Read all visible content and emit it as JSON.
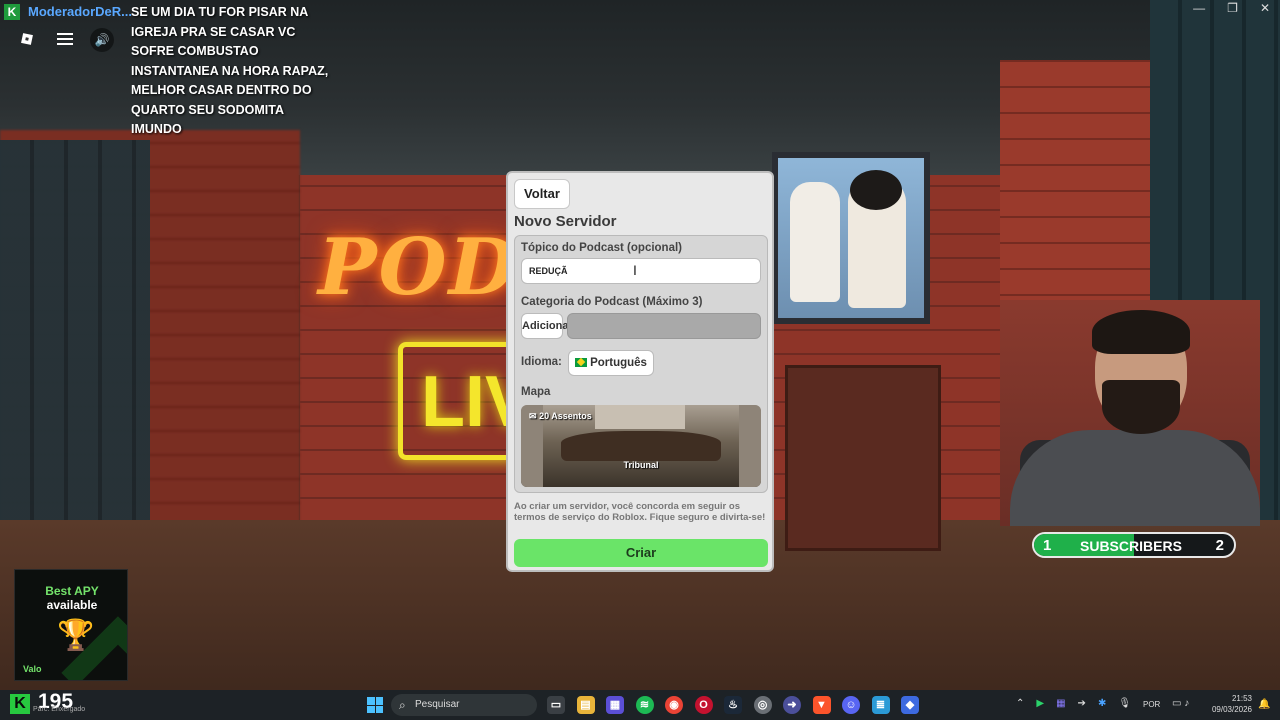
{
  "app": {
    "title_short": "Roblox"
  },
  "chat": {
    "username": "ModeradorDeR...",
    "message": "SE UM DIA TU FOR PISAR NA IGREJA PRA SE CASAR VC SOFRE COMBUSTAO INSTANTANEA NA HORA RAPAZ, MELHOR CASAR DENTRO DO QUARTO SEU SODOMITA IMUNDO"
  },
  "top_icons": [
    "roblox-menu-icon",
    "hamburger-icon",
    "speaker-icon"
  ],
  "dialog": {
    "back_label": "Voltar",
    "title": "Novo Servidor",
    "topic_label": "Tópico do Podcast (opcional)",
    "topic_value": "REDUÇÃ",
    "category_label": "Categoria do Podcast (Máximo 3)",
    "add_label": "Adicionar",
    "language_label": "Idioma:",
    "language_value": "Português",
    "map_label": "Mapa",
    "map_seats": "20 Assentos",
    "map_name": "Tribunal",
    "terms": "Ao criar um servidor, você concorda em seguir os termos de serviço do Roblox. Fique seguro e divirta-se!",
    "create_label": "Criar"
  },
  "scene_signs": {
    "neon_text": "PODC",
    "live_text": "LIV"
  },
  "subscribers": {
    "left": "1",
    "label": "SUBSCRIBERS",
    "right": "2",
    "progress": 0.5
  },
  "ad": {
    "line1": "Best APY",
    "line2": "available",
    "brand": "Valo"
  },
  "stream": {
    "viewer_count": "195",
    "viewer_sub": "Parc. Enxergado"
  },
  "taskbar": {
    "search_placeholder": "Pesquisar",
    "language": "POR",
    "time": "21:53",
    "date": "09/03/2026"
  },
  "colors": {
    "create_button": "#6ae468",
    "subscribers_fill": "#1fb04a",
    "chat_user": "#5aa8ff"
  }
}
